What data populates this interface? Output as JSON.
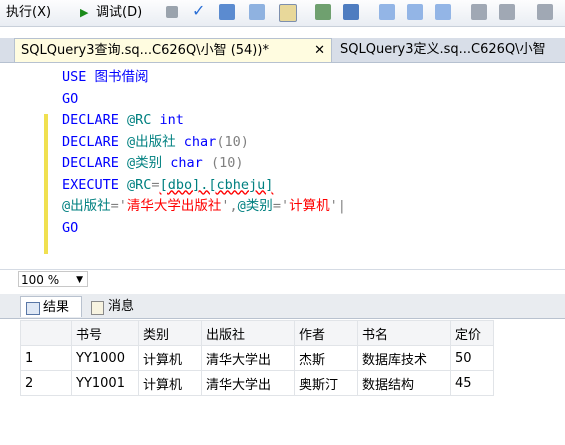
{
  "toolbar": {
    "execute_label": "执行(X)",
    "debug_label": "调试(D)"
  },
  "tabs": [
    {
      "label": "SQLQuery3查询.sq...C626Q\\小智 (54))*",
      "active": true,
      "close": "✕"
    },
    {
      "label": "SQLQuery3定义.sq...C626Q\\小智",
      "active": false
    }
  ],
  "editor": {
    "lines": [
      {
        "parts": [
          {
            "t": "USE ",
            "c": "kw"
          },
          {
            "t": "图书借阅",
            "c": "kw"
          }
        ]
      },
      {
        "parts": [
          {
            "t": "GO",
            "c": "kw"
          }
        ]
      },
      {
        "parts": [
          {
            "t": "DECLARE ",
            "c": "kw"
          },
          {
            "t": "@RC ",
            "c": "var"
          },
          {
            "t": "int",
            "c": "kw"
          }
        ]
      },
      {
        "parts": [
          {
            "t": "DECLARE ",
            "c": "kw"
          },
          {
            "t": "@出版社 ",
            "c": "var"
          },
          {
            "t": "char",
            "c": "kw"
          },
          {
            "t": "(10)",
            "c": "gray"
          }
        ]
      },
      {
        "parts": [
          {
            "t": "DECLARE ",
            "c": "kw"
          },
          {
            "t": "@类别 ",
            "c": "var"
          },
          {
            "t": "char ",
            "c": "kw"
          },
          {
            "t": "(10)",
            "c": "gray"
          }
        ]
      },
      {
        "parts": [
          {
            "t": "EXECUTE ",
            "c": "kw"
          },
          {
            "t": "@RC",
            "c": "var"
          },
          {
            "t": "=",
            "c": "gray"
          },
          {
            "t": "[dbo].[cbheju]",
            "c": "var squig"
          }
        ]
      },
      {
        "parts": [
          {
            "t": "@出版社",
            "c": "var"
          },
          {
            "t": "='",
            "c": "gray"
          },
          {
            "t": "清华大学出版社",
            "c": "str"
          },
          {
            "t": "',",
            "c": "gray"
          },
          {
            "t": "@类别",
            "c": "var"
          },
          {
            "t": "='",
            "c": "gray"
          },
          {
            "t": "计算机",
            "c": "str"
          },
          {
            "t": "'|",
            "c": "gray"
          }
        ]
      },
      {
        "parts": [
          {
            "t": "GO",
            "c": "kw"
          }
        ]
      }
    ]
  },
  "status": {
    "zoom": "100 %"
  },
  "results": {
    "tabs": [
      {
        "label": "结果",
        "active": true
      },
      {
        "label": "消息",
        "active": false
      }
    ],
    "columns": [
      "",
      "书号",
      "类别",
      "出版社",
      "作者",
      "书名",
      "定价"
    ],
    "rows": [
      [
        "1",
        "YY1000",
        "计算机",
        "清华大学出",
        "杰斯",
        "数据库技术",
        "50"
      ],
      [
        "2",
        "YY1001",
        "计算机",
        "清华大学出",
        "奥斯汀",
        "数据结构",
        "45"
      ]
    ]
  }
}
